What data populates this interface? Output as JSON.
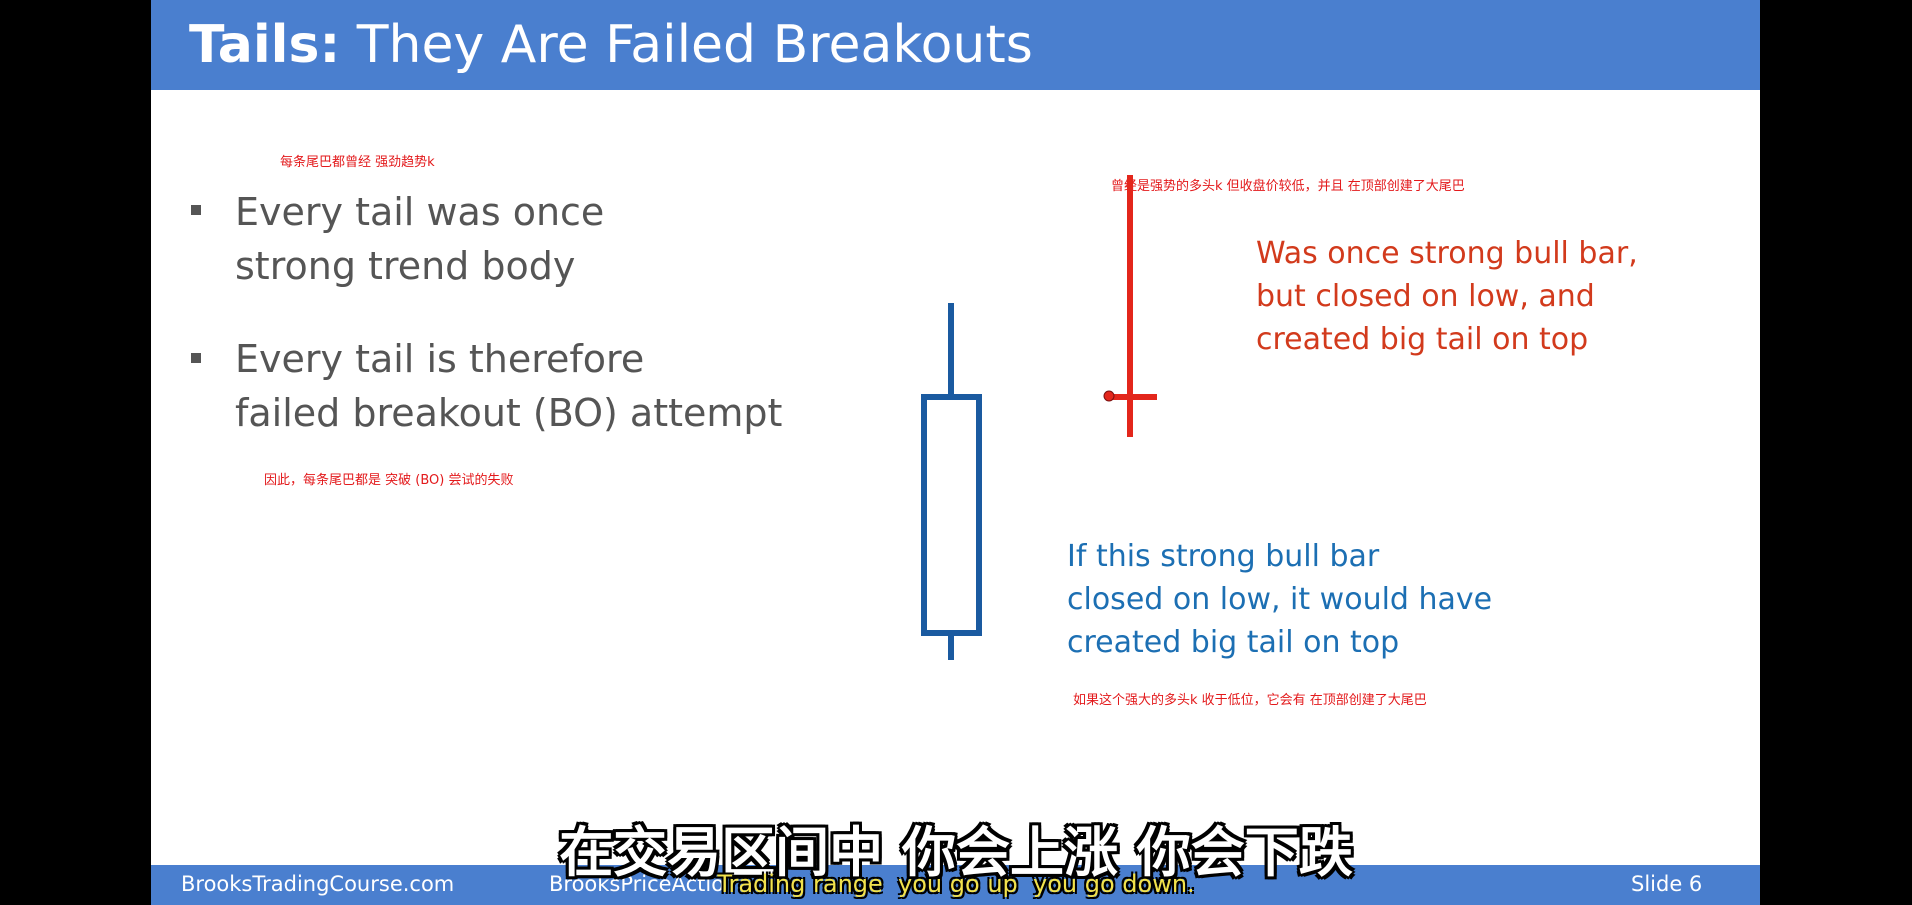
{
  "slide": {
    "title_bold": "Tails:",
    "title_rest": " They Are Failed Breakouts",
    "annotations": {
      "top_left_cn": "每条尾巴都曾经 强劲趋势k",
      "mid_left_cn": "因此，每条尾巴都是 突破 (BO) 尝试的失败",
      "top_right_cn": "曾经是强势的多头k 但收盘价较低，并且 在顶部创建了大尾巴",
      "bottom_right_cn": "如果这个强大的多头k 收于低位，它会有 在顶部创建了大尾巴"
    },
    "bullets": [
      {
        "line1": "Every tail was once",
        "line2": "strong trend body"
      },
      {
        "line1": "Every tail is therefore",
        "line2": "failed breakout (BO) attempt"
      }
    ],
    "callout_red": {
      "line1": "Was once strong bull bar,",
      "line2": "but closed on low, and",
      "line3": "created big tail on top"
    },
    "callout_blue": {
      "line1": "If this strong bull bar",
      "line2": "closed on low, it would have",
      "line3": "created big tail on top"
    },
    "colors": {
      "title_bar": "#4a7fcf",
      "bull_bar": "#1a5aa0",
      "tail_bar": "#e3261b",
      "red_text": "#d23a1c",
      "blue_text": "#1c6fb3"
    }
  },
  "footer": {
    "site_left": "BrooksTradingCourse.com",
    "site_mid": "BrooksPriceActio",
    "slide_label": "Slide  6"
  },
  "subtitles": {
    "chinese": "在交易区间中 你会上涨 你会下跌",
    "english": "Trading range  you go up  you go down."
  }
}
